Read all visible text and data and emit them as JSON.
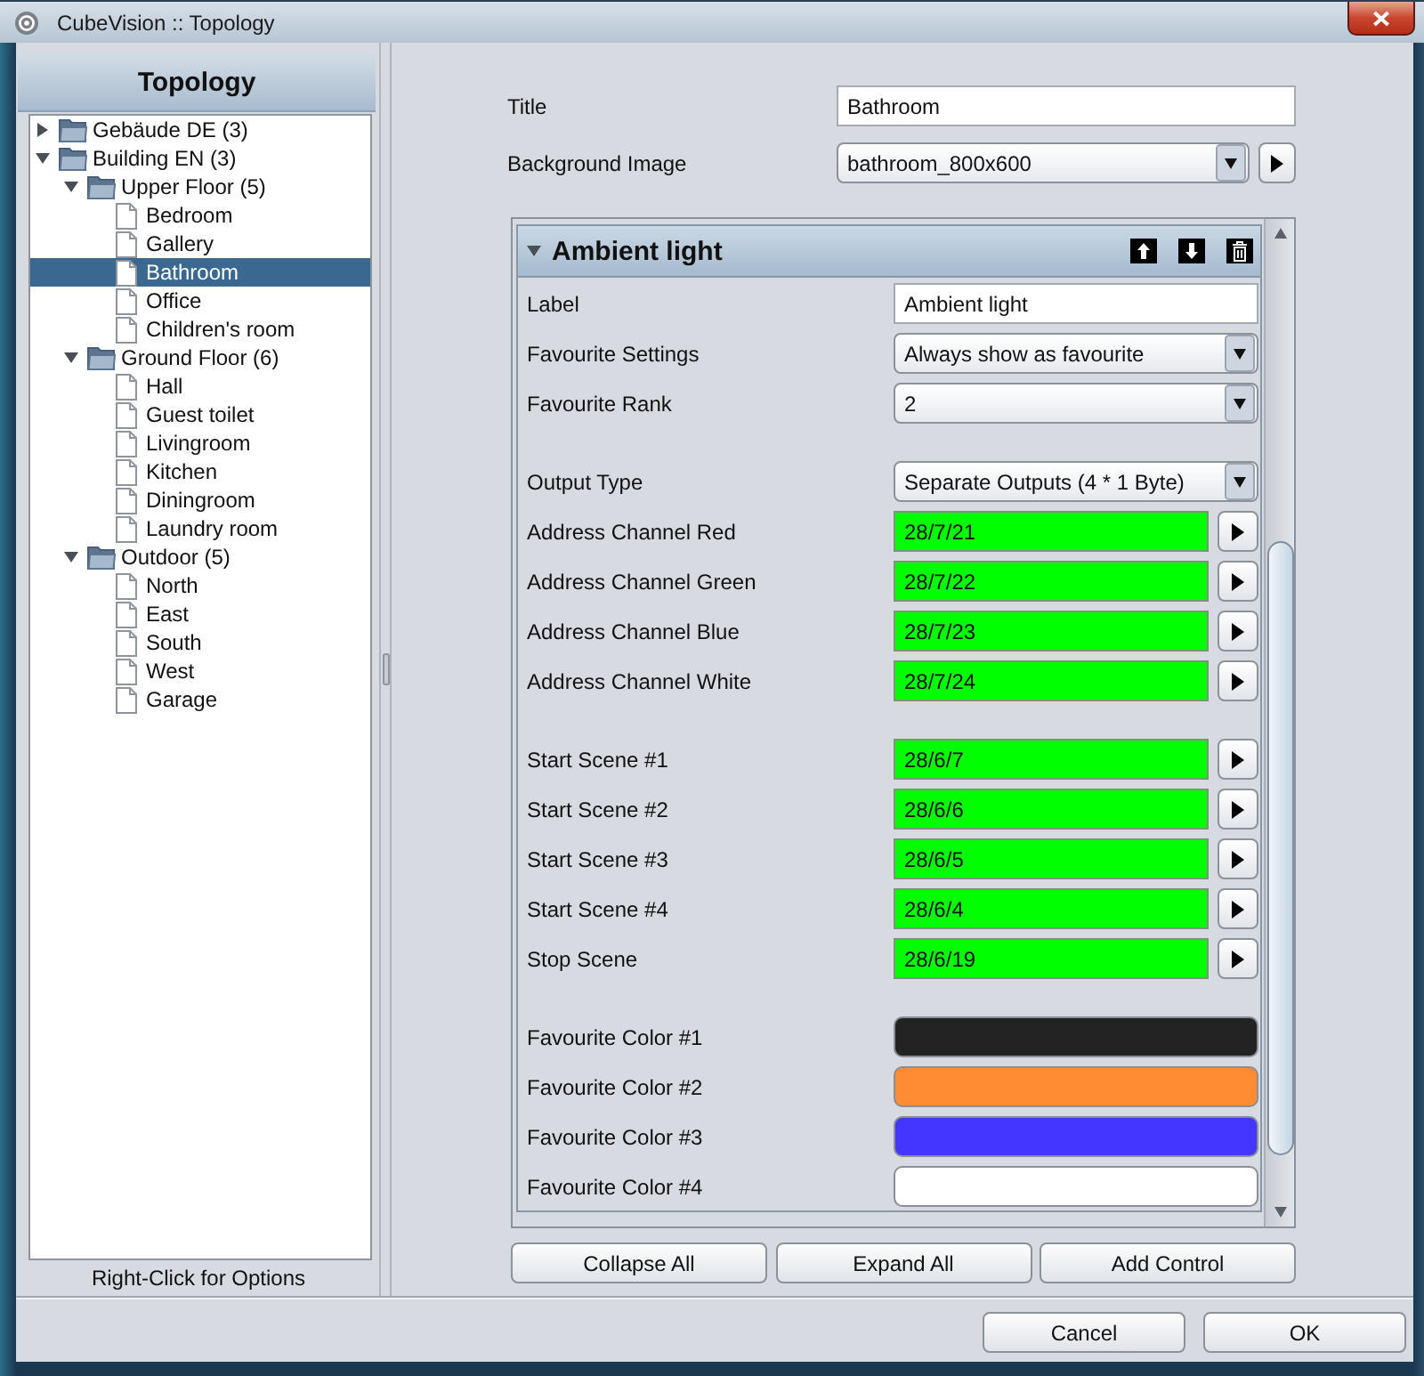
{
  "window": {
    "title": "CubeVision :: Topology"
  },
  "topology": {
    "title": "Topology",
    "tree": [
      {
        "kind": "folder",
        "label": "Gebäude DE (3)",
        "expanded": false,
        "selected": false
      },
      {
        "kind": "folder",
        "label": "Building EN (3)",
        "expanded": true,
        "selected": false,
        "children": [
          {
            "kind": "folder",
            "label": "Upper Floor (5)",
            "expanded": true,
            "selected": false,
            "children": [
              {
                "kind": "page",
                "label": "Bedroom",
                "selected": false
              },
              {
                "kind": "page",
                "label": "Gallery",
                "selected": false
              },
              {
                "kind": "page",
                "label": "Bathroom",
                "selected": true
              },
              {
                "kind": "page",
                "label": "Office",
                "selected": false
              },
              {
                "kind": "page",
                "label": "Children's room",
                "selected": false
              }
            ]
          },
          {
            "kind": "folder",
            "label": "Ground Floor (6)",
            "expanded": true,
            "selected": false,
            "children": [
              {
                "kind": "page",
                "label": "Hall",
                "selected": false
              },
              {
                "kind": "page",
                "label": "Guest toilet",
                "selected": false
              },
              {
                "kind": "page",
                "label": "Livingroom",
                "selected": false
              },
              {
                "kind": "page",
                "label": "Kitchen",
                "selected": false
              },
              {
                "kind": "page",
                "label": "Diningroom",
                "selected": false
              },
              {
                "kind": "page",
                "label": "Laundry room",
                "selected": false
              }
            ]
          },
          {
            "kind": "folder",
            "label": "Outdoor (5)",
            "expanded": true,
            "selected": false,
            "children": [
              {
                "kind": "page",
                "label": "North",
                "selected": false
              },
              {
                "kind": "page",
                "label": "East",
                "selected": false
              },
              {
                "kind": "page",
                "label": "South",
                "selected": false
              },
              {
                "kind": "page",
                "label": "West",
                "selected": false
              },
              {
                "kind": "page",
                "label": "Garage",
                "selected": false
              }
            ]
          }
        ]
      }
    ],
    "hint": "Right-Click for Options"
  },
  "properties": {
    "fields": [
      {
        "kind": "text",
        "label": "Title",
        "value": "Bathroom"
      },
      {
        "kind": "file",
        "label": "Background Image",
        "value": "bathroom_800x600"
      }
    ]
  },
  "controls": [
    {
      "title": "Ambient light",
      "expanded": true,
      "groups": [
        {
          "rows": [
            {
              "kind": "text",
              "label": "Label",
              "value": "Ambient light"
            },
            {
              "kind": "select",
              "label": "Favourite Settings",
              "value": "Always show as favourite"
            },
            {
              "kind": "select",
              "label": "Favourite Rank",
              "value": "2"
            }
          ]
        },
        {
          "rows": [
            {
              "kind": "select",
              "label": "Output Type",
              "value": "Separate Outputs (4 * 1 Byte)"
            },
            {
              "kind": "address",
              "label": "Address Channel Red",
              "value": "28/7/21",
              "valid": true
            },
            {
              "kind": "address",
              "label": "Address Channel Green",
              "value": "28/7/22",
              "valid": true
            },
            {
              "kind": "address",
              "label": "Address Channel Blue",
              "value": "28/7/23",
              "valid": true
            },
            {
              "kind": "address",
              "label": "Address Channel White",
              "value": "28/7/24",
              "valid": true
            }
          ]
        },
        {
          "rows": [
            {
              "kind": "address",
              "label": "Start Scene #1",
              "value": "28/6/7",
              "valid": true
            },
            {
              "kind": "address",
              "label": "Start Scene #2",
              "value": "28/6/6",
              "valid": true
            },
            {
              "kind": "address",
              "label": "Start Scene #3",
              "value": "28/6/5",
              "valid": true
            },
            {
              "kind": "address",
              "label": "Start Scene #4",
              "value": "28/6/4",
              "valid": true
            },
            {
              "kind": "address",
              "label": "Stop Scene",
              "value": "28/6/19",
              "valid": true
            }
          ]
        },
        {
          "rows": [
            {
              "kind": "color",
              "label": "Favourite Color #1",
              "color": "#232323"
            },
            {
              "kind": "color",
              "label": "Favourite Color #2",
              "color": "#ff8b32"
            },
            {
              "kind": "color",
              "label": "Favourite Color #3",
              "color": "#4536ff"
            },
            {
              "kind": "color",
              "label": "Favourite Color #4",
              "color": "#ffffff"
            }
          ]
        }
      ]
    }
  ],
  "panel_buttons": [
    "Collapse All",
    "Expand All",
    "Add Control"
  ],
  "dialog_buttons": [
    "Cancel",
    "OK"
  ]
}
